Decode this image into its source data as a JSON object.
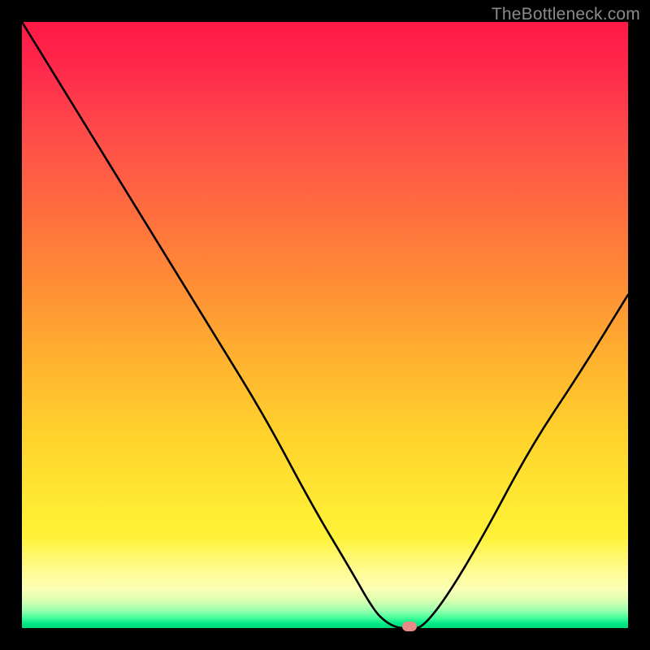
{
  "watermark": "TheBottleneck.com",
  "chart_data": {
    "type": "line",
    "title": "",
    "xlabel": "",
    "ylabel": "",
    "xlim": [
      0,
      100
    ],
    "ylim": [
      0,
      100
    ],
    "grid": false,
    "series": [
      {
        "name": "bottleneck-curve",
        "x": [
          0,
          8,
          16,
          24,
          32,
          40,
          48,
          54,
          58,
          60,
          62,
          64,
          66,
          70,
          76,
          84,
          92,
          100
        ],
        "values": [
          100,
          87,
          74,
          61,
          48,
          35,
          20,
          10,
          3,
          1,
          0,
          0,
          0,
          5,
          15,
          30,
          42,
          55
        ]
      }
    ],
    "marker": {
      "x": 64,
      "y": 0,
      "color": "#e88a88"
    },
    "gradient_stops": [
      {
        "pos": 0,
        "color": "#ff1846"
      },
      {
        "pos": 0.55,
        "color": "#ffd22c"
      },
      {
        "pos": 0.93,
        "color": "#fcffb5"
      },
      {
        "pos": 1.0,
        "color": "#00d878"
      }
    ]
  }
}
